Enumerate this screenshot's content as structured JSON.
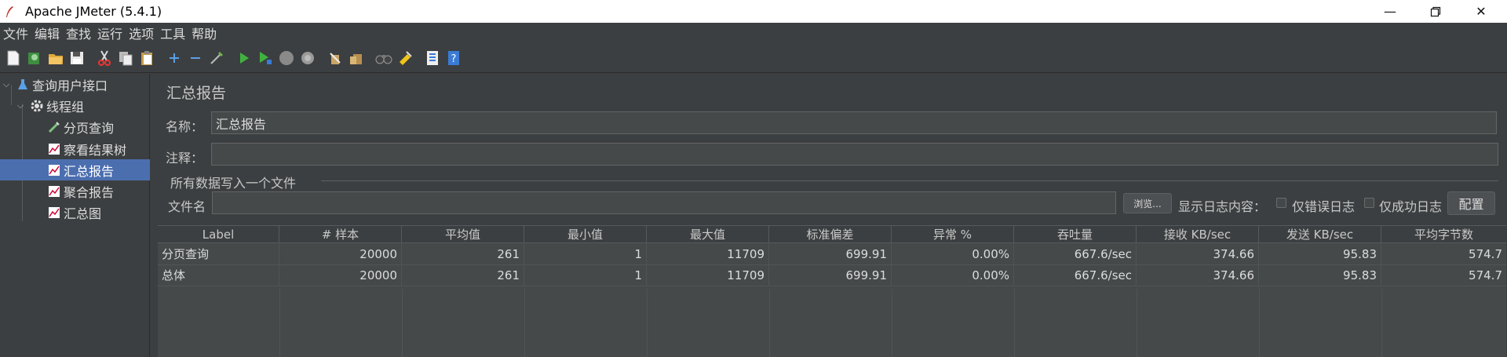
{
  "window": {
    "title": "Apache JMeter (5.4.1)"
  },
  "menu": [
    "文件",
    "编辑",
    "查找",
    "运行",
    "选项",
    "工具",
    "帮助"
  ],
  "toolbar_icons": [
    "new-icon",
    "templates-icon",
    "open-icon",
    "save-icon",
    "cut-icon",
    "copy-icon",
    "paste-icon",
    "expand-icon",
    "collapse-icon",
    "toggle-icon",
    "start-icon",
    "start-no-pause-icon",
    "stop-icon",
    "shutdown-icon",
    "clear-icon",
    "clear-all-icon",
    "search-icon",
    "reset-search-icon",
    "function-helper-icon",
    "help-icon"
  ],
  "tree": {
    "items": [
      {
        "label": "查询用户接口",
        "icon": "test-plan-icon",
        "level": 0
      },
      {
        "label": "线程组",
        "icon": "thread-group-gear-icon",
        "level": 1
      },
      {
        "label": "分页查询",
        "icon": "http-sampler-icon",
        "level": 2
      },
      {
        "label": "察看结果树",
        "icon": "listener-icon",
        "level": 2
      },
      {
        "label": "汇总报告",
        "icon": "listener-icon",
        "level": 2,
        "selected": true
      },
      {
        "label": "聚合报告",
        "icon": "listener-icon",
        "level": 2
      },
      {
        "label": "汇总图",
        "icon": "listener-icon",
        "level": 2
      }
    ]
  },
  "panel": {
    "title": "汇总报告",
    "name_label": "名称：",
    "name_value": "汇总报告",
    "comment_label": "注释：",
    "comment_value": "",
    "group_title": "所有数据写入一个文件",
    "filename_label": "文件名",
    "filename_value": "",
    "browse_label": "浏览...",
    "log_content_label": "显示日志内容：",
    "errors_only_label": "仅错误日志",
    "success_only_label": "仅成功日志",
    "configure_label": "配置"
  },
  "table": {
    "headers": [
      "Label",
      "# 样本",
      "平均值",
      "最小值",
      "最大值",
      "标准偏差",
      "异常 %",
      "吞吐量",
      "接收 KB/sec",
      "发送 KB/sec",
      "平均字节数"
    ],
    "rows": [
      [
        "分页查询",
        "20000",
        "261",
        "1",
        "11709",
        "699.91",
        "0.00%",
        "667.6/sec",
        "374.66",
        "95.83",
        "574.7"
      ],
      [
        "总体",
        "20000",
        "261",
        "1",
        "11709",
        "699.91",
        "0.00%",
        "667.6/sec",
        "374.66",
        "95.83",
        "574.7"
      ]
    ]
  },
  "colors": {
    "selection": "#4b6eaf",
    "background": "#3c3f41",
    "field": "#45494a"
  }
}
